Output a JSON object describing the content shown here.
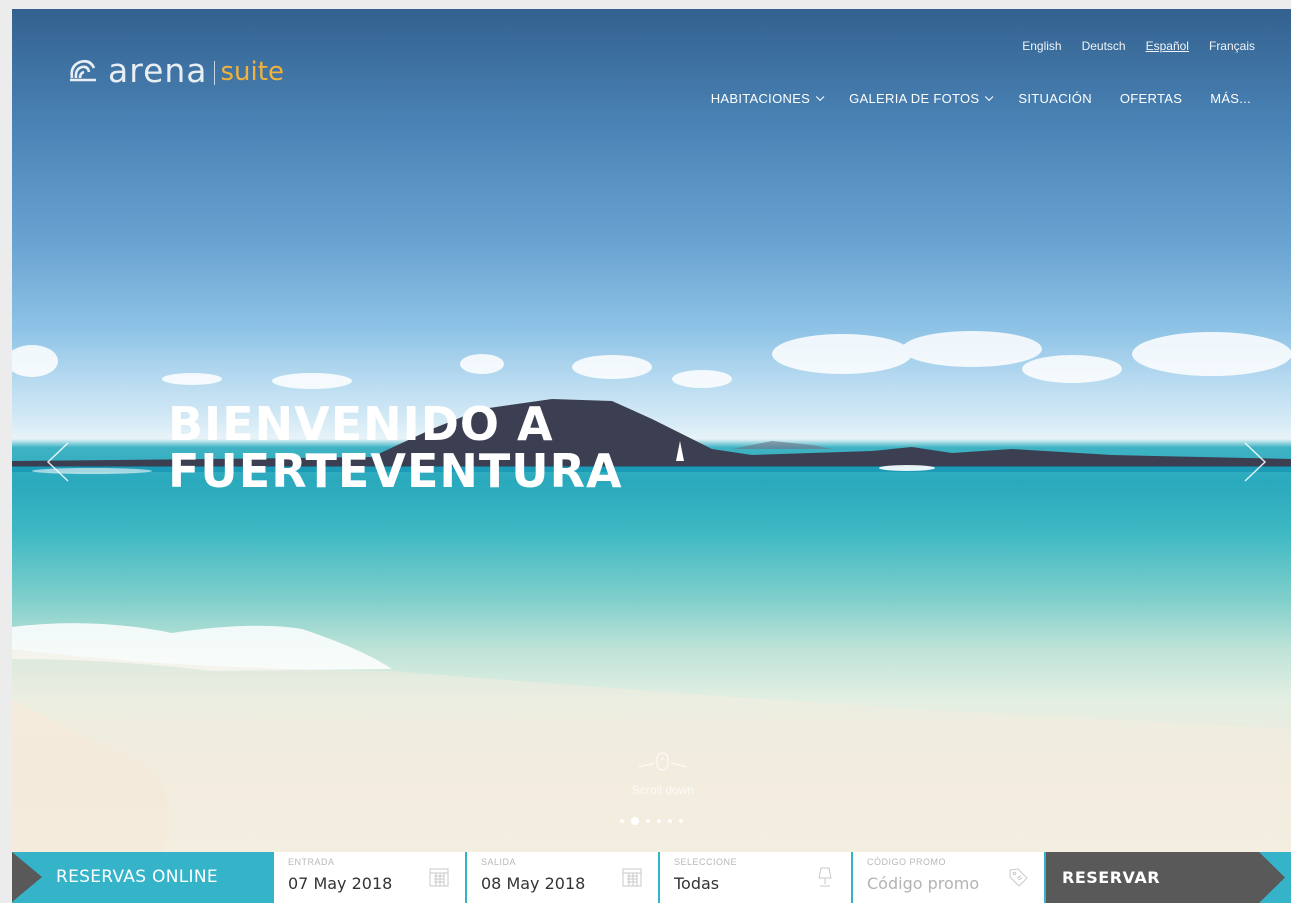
{
  "brand": {
    "name": "arena",
    "sub": "suite",
    "accent_color": "#f2b23a"
  },
  "languages": [
    {
      "label": "English",
      "active": false
    },
    {
      "label": "Deutsch",
      "active": false
    },
    {
      "label": "Español",
      "active": true
    },
    {
      "label": "Français",
      "active": false
    }
  ],
  "nav": {
    "habitaciones": "HABITACIONES",
    "galeria": "GALERIA DE FOTOS",
    "situacion": "SITUACIÓN",
    "ofertas": "OFERTAS",
    "mas": "MÁS..."
  },
  "hero": {
    "line1": "BIENVENIDO A",
    "line2": "FUERTEVENTURA",
    "scroll_label": "Scroll down",
    "slide_count": 6,
    "active_slide": 2
  },
  "booking": {
    "title": "RESERVAS ONLINE",
    "checkin": {
      "caption": "ENTRADA",
      "value": "07 May 2018"
    },
    "checkout": {
      "caption": "SALIDA",
      "value": "08 May 2018"
    },
    "room": {
      "caption": "SELECCIONE",
      "value": "Todas"
    },
    "promo": {
      "caption": "CÓDIGO PROMO",
      "placeholder": "Código promo"
    },
    "submit": "RESERVAR",
    "bar_color": "#35b3c9",
    "button_color": "#595959"
  },
  "icons": [
    "shell-logo-icon",
    "chevron-down-icon",
    "arrow-left-icon",
    "arrow-right-icon",
    "mouse-icon",
    "calendar-icon",
    "lamp-icon",
    "tag-icon"
  ]
}
